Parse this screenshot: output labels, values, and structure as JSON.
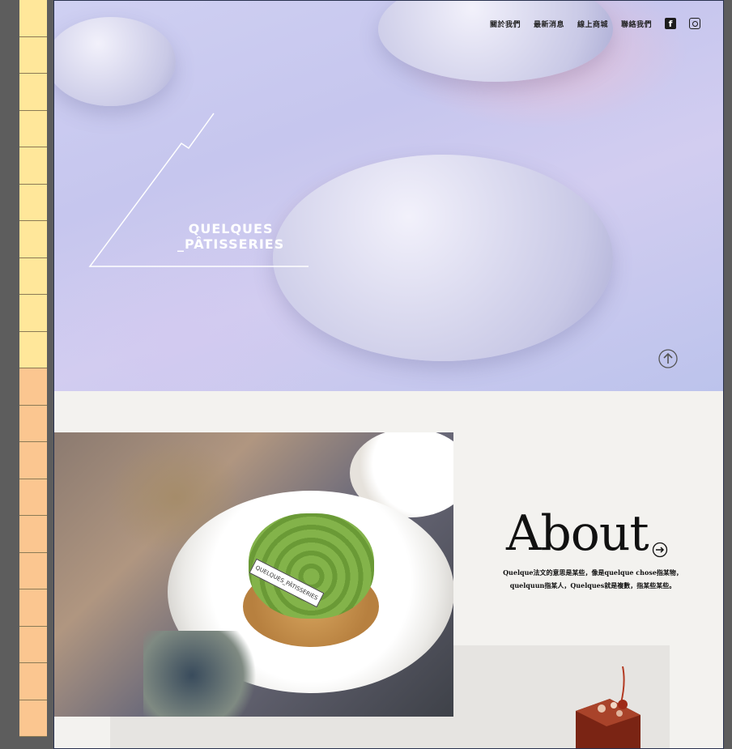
{
  "nav": {
    "items": [
      "關於我們",
      "最新消息",
      "線上商城",
      "聯絡我們"
    ],
    "facebook_glyph": "f"
  },
  "hero": {
    "brand_line1": "QUELQUES",
    "brand_line2": "_PÂTISSERIES"
  },
  "about": {
    "title": "About",
    "line1": "Quelque法文的意思是某些，像是quelque chose指某物，",
    "line2": "quelquun指某人，Quelques就是複數，指某些某些。",
    "tag_text": "QUELQUES_PÂTISSERIES"
  },
  "icons": [
    "facebook-icon",
    "instagram-icon",
    "scroll-up-icon",
    "arrow-right-circle-icon"
  ],
  "colors": {
    "hero_bg": "#c6c6ee",
    "page_bg": "#f3f2ef",
    "text": "#111111",
    "gutter_yellow": "#ffe79a",
    "gutter_orange": "#fbc690"
  }
}
